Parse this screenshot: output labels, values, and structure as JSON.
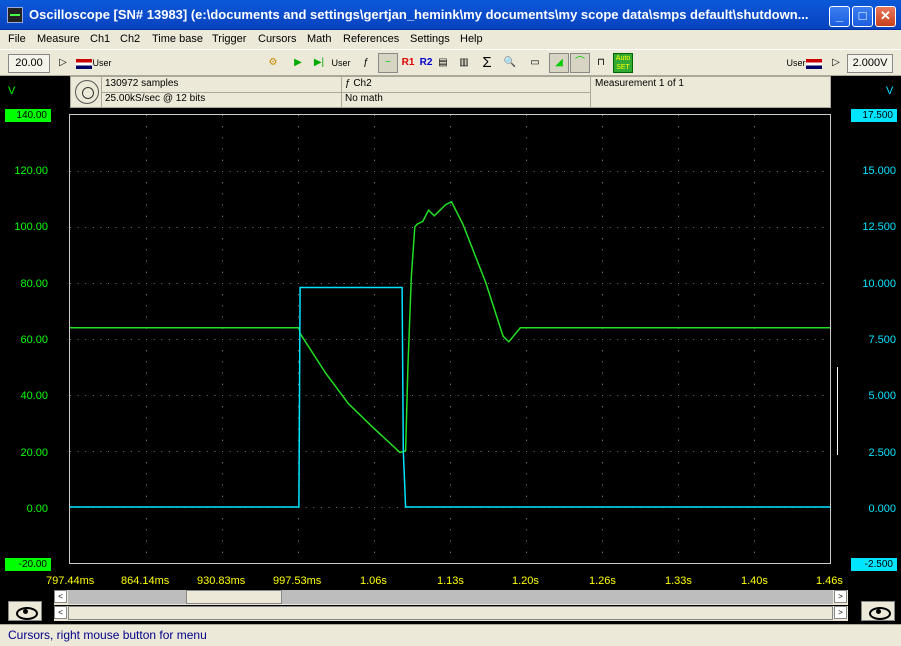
{
  "window": {
    "title": "Oscilloscope  [SN# 13983]  (e:\\documents and settings\\gertjan_hemink\\my documents\\my scope data\\smps default\\shutdown...",
    "minimize": "_",
    "maximize": "□",
    "close": "✕"
  },
  "menu": [
    "File",
    "Measure",
    "Ch1",
    "Ch2",
    "Time base",
    "Trigger",
    "Cursors",
    "Math",
    "References",
    "Settings",
    "Help"
  ],
  "toolbar": {
    "ch1_range": "20.00",
    "ch1_user": "User",
    "ch2_user": "User",
    "ch2_range": "2.000V",
    "r1": "R1",
    "r2": "R2",
    "user_mid": "User",
    "autoset": "Auto SET",
    "sigma": "Σ"
  },
  "info": {
    "samples": "130972 samples",
    "rate": "25.00kS/sec @ 12 bits",
    "trigger": "ƒ Ch2",
    "math": "No math",
    "measurement": "Measurement 1 of 1"
  },
  "left_axis": {
    "unit": "V",
    "top_badge": "140.00",
    "bottom_badge": "-20.00",
    "labels": [
      "120.00",
      "100.00",
      "80.00",
      "60.00",
      "40.00",
      "20.00",
      "0.00"
    ],
    "color": "#00ff00"
  },
  "right_axis": {
    "unit": "V",
    "top_badge": "17.500",
    "bottom_badge": "-2.500",
    "labels": [
      "15.000",
      "12.500",
      "10.000",
      "7.500",
      "5.000",
      "2.500",
      "0.000"
    ],
    "color": "#00e5ff"
  },
  "x_axis": {
    "labels": [
      "797.44ms",
      "864.14ms",
      "930.83ms",
      "997.53ms",
      "1.06s",
      "1.13s",
      "1.20s",
      "1.26s",
      "1.33s",
      "1.40s",
      "1.46s"
    ]
  },
  "chart_data": {
    "type": "line",
    "x_range_s": [
      0.79744,
      1.46
    ],
    "ylim_left": [
      -20,
      140
    ],
    "ylim_right": [
      -2.5,
      17.5
    ],
    "series": [
      {
        "axis": "left",
        "color": "#22e022",
        "x": [
          0.79744,
          0.997,
          0.998,
          1.02,
          1.04,
          1.06,
          1.085,
          1.09,
          1.092,
          1.095,
          1.098,
          1.1,
          1.105,
          1.11,
          1.115,
          1.12,
          1.125,
          1.13,
          1.14,
          1.16,
          1.175,
          1.18,
          1.19,
          1.46
        ],
        "y": [
          64,
          64,
          62,
          48,
          37,
          29,
          19.5,
          20,
          50,
          82,
          100,
          101,
          102,
          106,
          104,
          106,
          108,
          109,
          101,
          80,
          61,
          59,
          64,
          64
        ]
      },
      {
        "axis": "right",
        "color": "#00e5ff",
        "x": [
          0.79744,
          0.997,
          0.998,
          1.087,
          1.088,
          1.09,
          1.46
        ],
        "y": [
          0,
          0,
          9.8,
          9.8,
          2.5,
          0,
          0
        ]
      }
    ]
  },
  "scrollbar": {
    "left_arrow": "<",
    "right_arrow": ">"
  },
  "status": "Cursors, right mouse button for menu"
}
